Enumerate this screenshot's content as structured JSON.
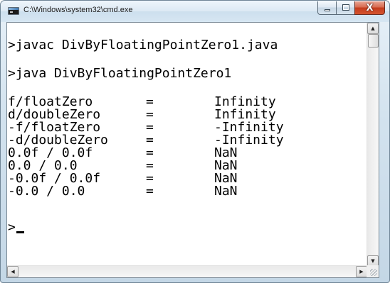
{
  "window": {
    "title": "C:\\Windows\\system32\\cmd.exe",
    "app_icon": "cmd-icon",
    "caption_buttons": {
      "minimize": "minimize-icon",
      "maximize": "maximize-icon",
      "close": "close-icon",
      "close_glyph": "X"
    }
  },
  "console": {
    "commands": [
      ">javac DivByFloatingPointZero1.java",
      ">java DivByFloatingPointZero1"
    ],
    "results": [
      {
        "expr": "f/floatZero",
        "eq": "=",
        "value": "Infinity"
      },
      {
        "expr": "d/doubleZero",
        "eq": "=",
        "value": "Infinity"
      },
      {
        "expr": "-f/floatZero",
        "eq": "=",
        "value": "-Infinity"
      },
      {
        "expr": "-d/doubleZero",
        "eq": "=",
        "value": "-Infinity"
      },
      {
        "expr": "0.0f / 0.0f",
        "eq": "=",
        "value": "NaN"
      },
      {
        "expr": "0.0 / 0.0",
        "eq": "=",
        "value": "NaN"
      },
      {
        "expr": "-0.0f / 0.0f",
        "eq": "=",
        "value": "NaN"
      },
      {
        "expr": "-0.0 / 0.0",
        "eq": "=",
        "value": "NaN"
      }
    ],
    "prompt": ">"
  },
  "scrollbars": {
    "up": "scroll-up-icon",
    "down": "scroll-down-icon",
    "left": "scroll-left-icon",
    "right": "scroll-right-icon",
    "up_glyph": "▲",
    "down_glyph": "▼",
    "left_glyph": "◀",
    "right_glyph": "▶"
  }
}
